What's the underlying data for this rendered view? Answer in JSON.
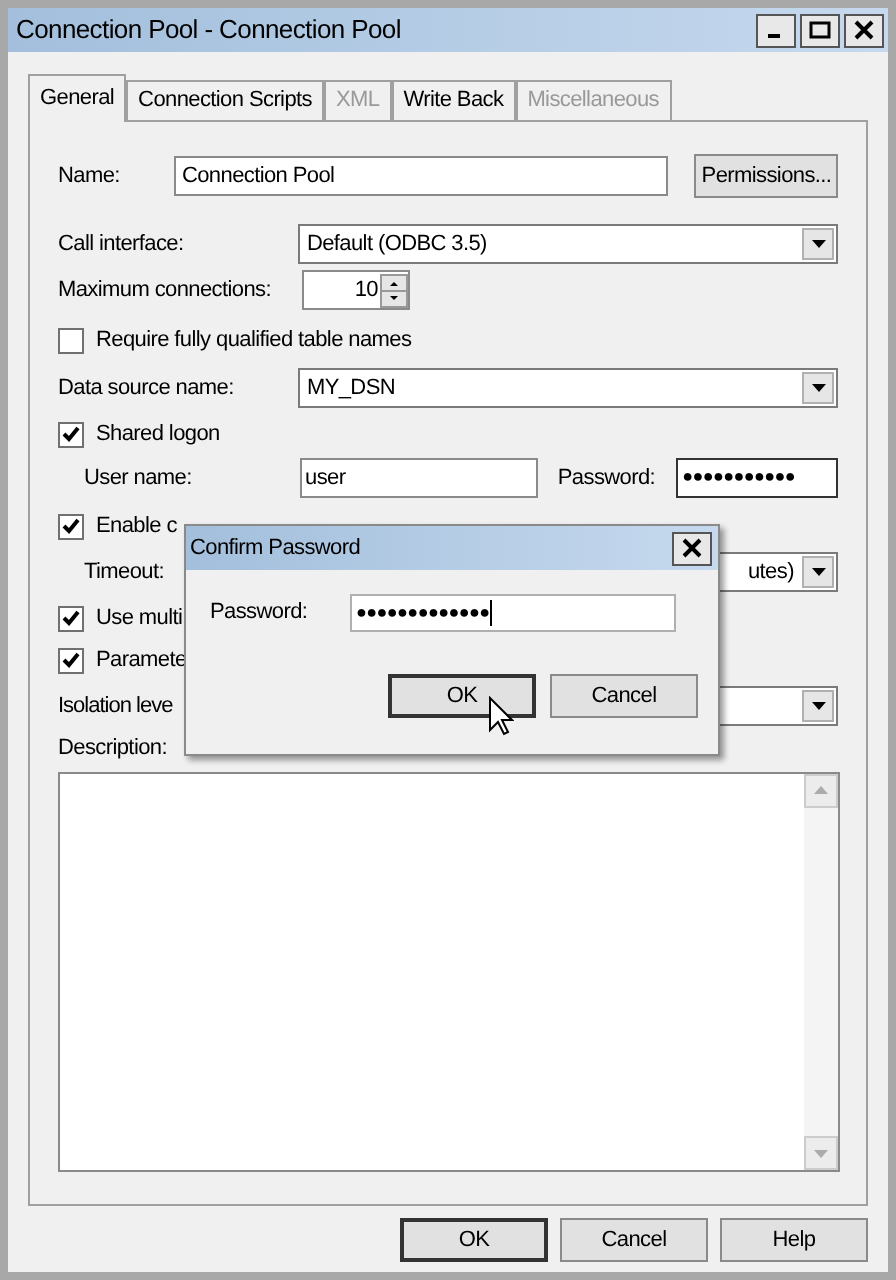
{
  "window": {
    "title": "Connection Pool - Connection Pool"
  },
  "tabs": [
    {
      "label": "General",
      "selected": true,
      "disabled": false
    },
    {
      "label": "Connection Scripts",
      "selected": false,
      "disabled": false
    },
    {
      "label": "XML",
      "selected": false,
      "disabled": true
    },
    {
      "label": "Write Back",
      "selected": false,
      "disabled": false
    },
    {
      "label": "Miscellaneous",
      "selected": false,
      "disabled": true
    }
  ],
  "name": {
    "label": "Name:",
    "value": "Connection Pool",
    "button": "Permissions..."
  },
  "call_interface": {
    "label": "Call interface:",
    "value": "Default (ODBC 3.5)"
  },
  "max_connections": {
    "label": "Maximum connections:",
    "value": "10"
  },
  "require_qualified": {
    "label": "Require fully qualified table names",
    "checked": false
  },
  "data_source": {
    "label": "Data source name:",
    "value": "MY_DSN"
  },
  "shared_logon": {
    "label": "Shared logon",
    "checked": true
  },
  "user_name": {
    "label": "User name:",
    "value": "user"
  },
  "password": {
    "label": "Password:",
    "value": "●●●●●●●●●●●"
  },
  "enable_connection": {
    "label": "Enable c",
    "checked": true
  },
  "timeout": {
    "label": "Timeout:",
    "value": "utes)"
  },
  "use_multi": {
    "label": "Use multi",
    "checked": true
  },
  "parameters": {
    "label": "Paramete",
    "checked": true
  },
  "isolation": {
    "label": "Isolation leve"
  },
  "description": {
    "label": "Description:"
  },
  "buttons": [
    "OK",
    "Cancel",
    "Help"
  ],
  "confirm_dialog": {
    "title": "Confirm Password",
    "label": "Password:",
    "value": "●●●●●●●●●●●●●",
    "buttons": [
      "OK",
      "Cancel"
    ]
  }
}
